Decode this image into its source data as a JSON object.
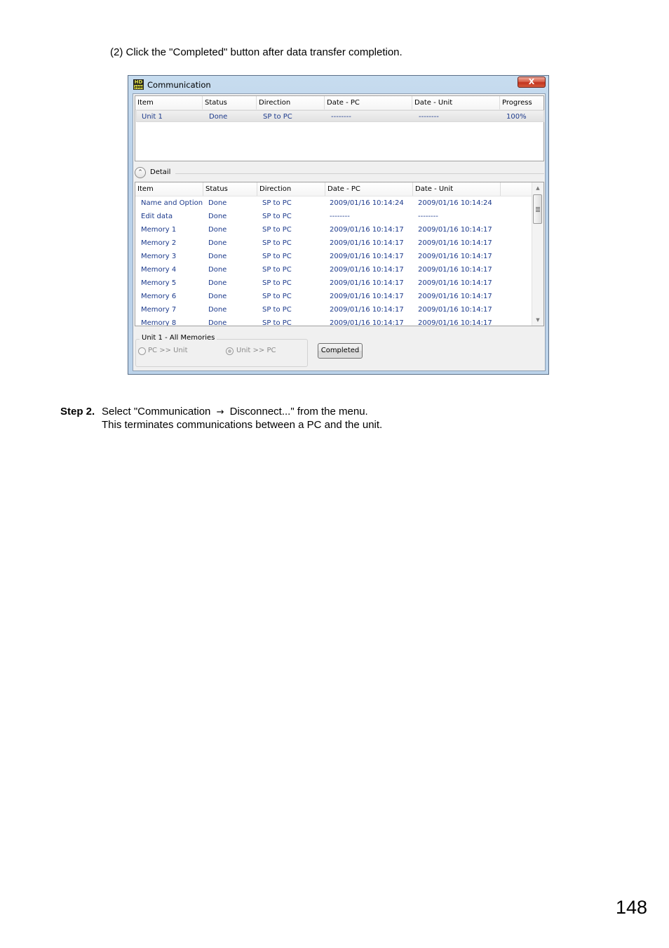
{
  "instruction": "(2) Click the \"Completed\" button after data transfer completion.",
  "window": {
    "title": "Communication",
    "close_glyph": "X",
    "icon_text_top": "HD",
    "icon_text_bottom": "2000"
  },
  "top_list": {
    "columns": [
      "Item",
      "Status",
      "Direction",
      "Date - PC",
      "Date - Unit",
      "Progress"
    ],
    "rows": [
      [
        "Unit 1",
        "Done",
        "SP to PC",
        "--------",
        "--------",
        "100%"
      ]
    ]
  },
  "detail": {
    "toggle_glyph": "⌃",
    "label": "Detail",
    "columns": [
      "Item",
      "Status",
      "Direction",
      "Date - PC",
      "Date - Unit"
    ],
    "rows": [
      [
        "Name and Option",
        "Done",
        "SP to PC",
        "2009/01/16 10:14:24",
        "2009/01/16 10:14:24"
      ],
      [
        "Edit data",
        "Done",
        "SP to PC",
        "--------",
        "--------"
      ],
      [
        "Memory 1",
        "Done",
        "SP to PC",
        "2009/01/16 10:14:17",
        "2009/01/16 10:14:17"
      ],
      [
        "Memory 2",
        "Done",
        "SP to PC",
        "2009/01/16 10:14:17",
        "2009/01/16 10:14:17"
      ],
      [
        "Memory 3",
        "Done",
        "SP to PC",
        "2009/01/16 10:14:17",
        "2009/01/16 10:14:17"
      ],
      [
        "Memory 4",
        "Done",
        "SP to PC",
        "2009/01/16 10:14:17",
        "2009/01/16 10:14:17"
      ],
      [
        "Memory 5",
        "Done",
        "SP to PC",
        "2009/01/16 10:14:17",
        "2009/01/16 10:14:17"
      ],
      [
        "Memory 6",
        "Done",
        "SP to PC",
        "2009/01/16 10:14:17",
        "2009/01/16 10:14:17"
      ],
      [
        "Memory 7",
        "Done",
        "SP to PC",
        "2009/01/16 10:14:17",
        "2009/01/16 10:14:17"
      ],
      [
        "Memory 8",
        "Done",
        "SP to PC",
        "2009/01/16 10:14:17",
        "2009/01/16 10:14:17"
      ]
    ]
  },
  "transfer_group": {
    "title": "Unit 1 - All Memories",
    "option_pc_to_unit": "PC >> Unit",
    "option_unit_to_pc": "Unit >> PC",
    "selected": "Unit >> PC"
  },
  "completed_button": "Completed",
  "step": {
    "label": "Step 2.",
    "line1_before": "Select \"Communication",
    "arrow": "→",
    "line1_after": "Disconnect...\" from the menu.",
    "line2": "This terminates communications between a PC and the unit."
  },
  "page_number": "148"
}
